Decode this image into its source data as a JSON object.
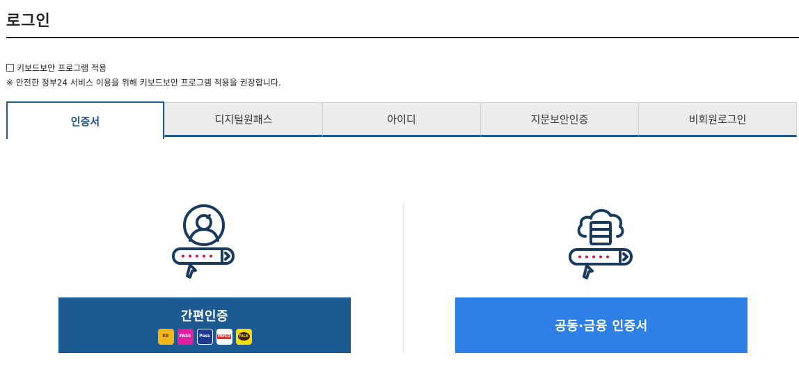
{
  "page": {
    "title": "로그인"
  },
  "keyboard_security": {
    "checkbox_label": "키보드보안 프로그램 적용",
    "notice": "※ 안전한 정부24 서비스 이용을 위해 키보드보안 프로그램 적용을 권장합니다."
  },
  "tabs": [
    {
      "label": "인증서",
      "active": true
    },
    {
      "label": "디지털원패스",
      "active": false
    },
    {
      "label": "아이디",
      "active": false
    },
    {
      "label": "지문보안인증",
      "active": false
    },
    {
      "label": "비회원로그인",
      "active": false
    }
  ],
  "options": {
    "simple_auth": {
      "label": "간편인증",
      "icon": "user-password-icon",
      "providers": [
        {
          "name": "kb-logo",
          "text": "KB"
        },
        {
          "name": "pass-logo",
          "text": "PASS"
        },
        {
          "name": "samsung-pass-logo",
          "text": "Pass"
        },
        {
          "name": "payco-logo",
          "text": "PAYCO"
        },
        {
          "name": "kakao-talk-logo",
          "text": "TALK"
        }
      ]
    },
    "certificate": {
      "label": "공동·금융 인증서",
      "icon": "cloud-certificate-icon"
    }
  },
  "colors": {
    "primary_dark": "#1d5a91",
    "primary_light": "#2f80e6",
    "icon_navy": "#173a5e",
    "icon_red": "#d3163d",
    "tab_border": "#1f5a8e"
  }
}
